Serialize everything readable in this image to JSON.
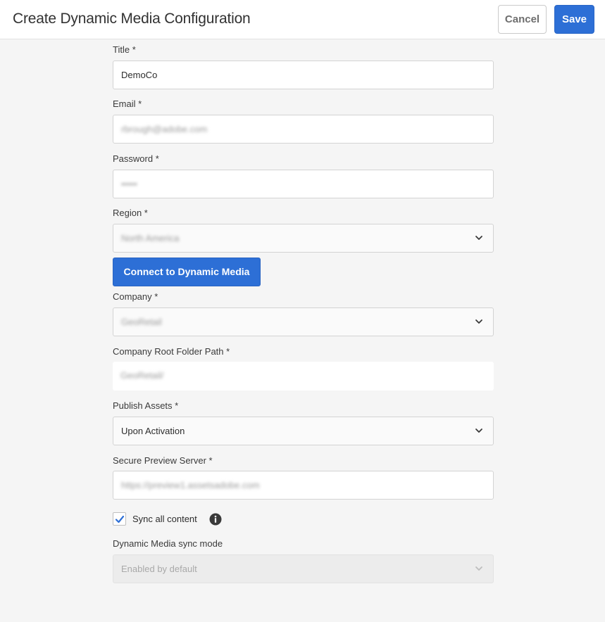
{
  "header": {
    "title": "Create Dynamic Media Configuration",
    "cancel_label": "Cancel",
    "save_label": "Save"
  },
  "form": {
    "title": {
      "label": "Title *",
      "value": "DemoCo"
    },
    "email": {
      "label": "Email *",
      "value": "rbrough@adobe.com"
    },
    "password": {
      "label": "Password *",
      "value": "•••••"
    },
    "region": {
      "label": "Region *",
      "value": "North America"
    },
    "connect_label": "Connect to Dynamic Media",
    "company": {
      "label": "Company *",
      "value": "GeoRetail"
    },
    "root_folder": {
      "label": "Company Root Folder Path *",
      "value": "GeoRetail/"
    },
    "publish_assets": {
      "label": "Publish Assets *",
      "value": "Upon Activation"
    },
    "preview_server": {
      "label": "Secure Preview Server *",
      "value": "https://preview1.assetsadobe.com"
    },
    "sync_all": {
      "label": "Sync all content",
      "checked": true
    },
    "sync_mode": {
      "label": "Dynamic Media sync mode",
      "value": "Enabled by default"
    }
  },
  "icons": {
    "chevron": "chevron-down-icon",
    "check": "checkmark-icon",
    "info": "info-icon"
  },
  "colors": {
    "accent": "#2d6fd6",
    "background": "#f5f5f5"
  }
}
